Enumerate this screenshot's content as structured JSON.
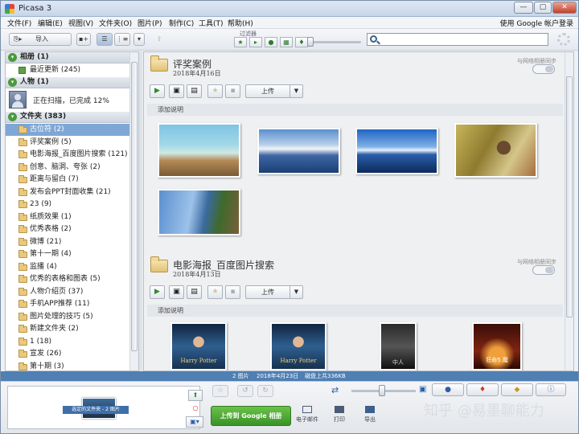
{
  "window": {
    "title": "Picasa 3",
    "minimize_label": "—",
    "maximize_label": "▢",
    "close_label": "✕"
  },
  "menu": {
    "items": [
      "文件(F)",
      "编辑(E)",
      "视图(V)",
      "文件夹(O)",
      "图片(P)",
      "制作(C)",
      "工具(T)",
      "帮助(H)"
    ],
    "account": "使用 Google 帐户登录"
  },
  "toolbar": {
    "import_label": "导入",
    "filter_label": "过滤器",
    "search": {
      "placeholder": ""
    }
  },
  "sidebar": {
    "albums_header": "相册 (1)",
    "recent_updates": "最近更新 (245)",
    "people_header": "人物 (1)",
    "scan_status": "正在扫描，已完成 12%",
    "folders_header": "文件夹 (383)",
    "folders": [
      "古位符 (2)",
      "评奖案例 (5)",
      "电影海报_百度图片搜索 (121)",
      "创意、脑洞、夸张 (2)",
      "距离与留白 (7)",
      "发布会PPT封面收集 (21)",
      "23 (9)",
      "纸质效果 (1)",
      "优秀表格 (2)",
      "微博 (21)",
      "第十一期 (4)",
      "监播 (4)",
      "优秀的表格和图表 (5)",
      "人物介绍页 (37)",
      "手机APP推荐 (11)",
      "图片处理的技巧 (5)",
      "新建文件夹 (2)",
      "1 (18)",
      "宣发 (26)",
      "第十期 (3)"
    ],
    "selected_index": 0
  },
  "albums": [
    {
      "title": "评奖案例",
      "date": "2018年4月16日",
      "sync_label": "与网络相册同步",
      "upload_label": "上传",
      "caption_placeholder": "添加说明"
    },
    {
      "title": "电影海报_百度图片搜索",
      "date": "2018年4月13日",
      "sync_label": "与网络相册同步",
      "upload_label": "上传",
      "caption_placeholder": "添加说明"
    }
  ],
  "posters": [
    "Harry Potter",
    "Harry Potter",
    "中人",
    "狂命5 魔"
  ],
  "status": {
    "count": "2 图片",
    "date": "2018年4月23日",
    "disk": "磁盘上共336KB"
  },
  "tray": {
    "selection_label": "选定的文件夹 - 2 图片",
    "upload_google": "上传到 Google 相册",
    "email": "电子邮件",
    "print": "打印",
    "export": "导出"
  },
  "watermark": "知乎 @易墨聊能力",
  "colors": {
    "accent": "#4f7fb3",
    "selection": "#7ea7d6",
    "upload_green": "#4aa532"
  }
}
